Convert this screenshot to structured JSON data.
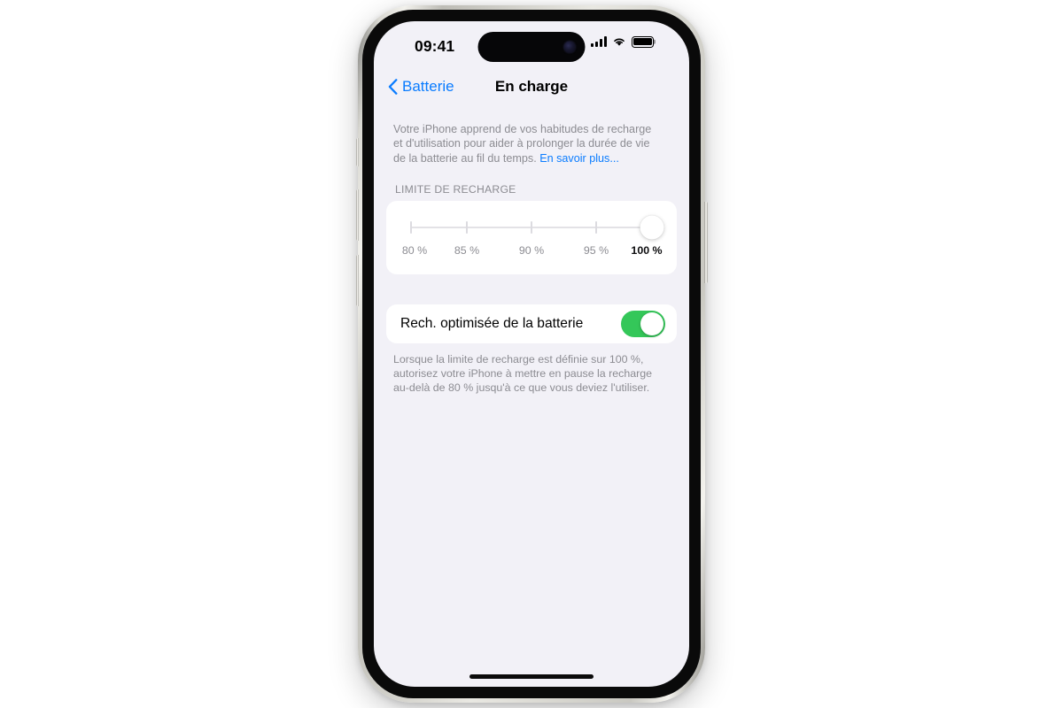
{
  "status_bar": {
    "time": "09:41",
    "cellular_icon": "cellular-bars-icon",
    "wifi_icon": "wifi-icon",
    "battery_icon": "battery-full-icon",
    "dynamic_island": "dynamic-island",
    "camera_icon": "front-camera-lens-icon"
  },
  "nav": {
    "back_label": "Batterie",
    "back_icon": "chevron-left-icon",
    "title": "En charge"
  },
  "intro": {
    "text": "Votre iPhone apprend de vos habitudes de recharge et d'utilisation pour aider à prolonger la durée de vie de la batterie au fil du temps. ",
    "link_label": "En savoir plus..."
  },
  "charge_limit": {
    "section_header": "LIMITE DE RECHARGE",
    "ticks": [
      "80 %",
      "85 %",
      "90 %",
      "95 %",
      "100 %"
    ],
    "selected_index": 4,
    "selected_value": "100 %"
  },
  "optimized_charging": {
    "label": "Rech. optimisée de la batterie",
    "toggle_state": "on",
    "footnote": "Lorsque la limite de recharge est définie sur 100 %, autorisez votre iPhone à mettre en pause la recharge au-delà de 80 % jusqu'à ce que vous deviez l'utiliser."
  },
  "home_indicator": "home-indicator",
  "colors": {
    "accent_blue": "#0A7CFF",
    "toggle_green": "#34C759",
    "background": "#F2F1F7",
    "card": "#FFFFFF",
    "secondary_text": "#8C8C92"
  }
}
